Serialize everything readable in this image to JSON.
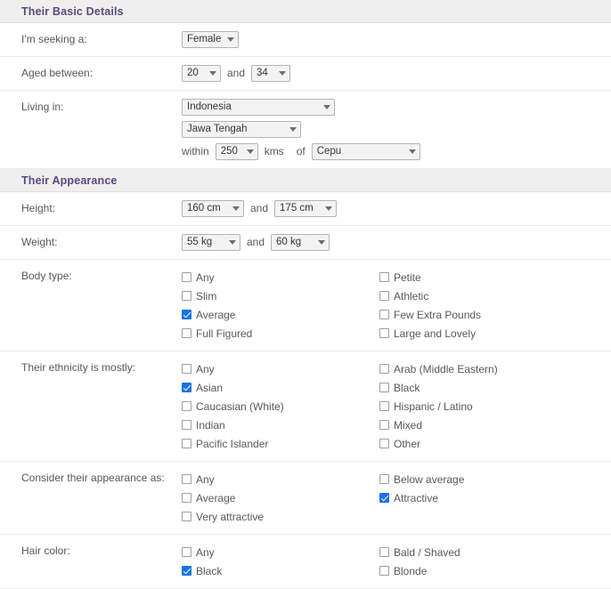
{
  "sections": [
    {
      "id": "basic-details",
      "title": "Their Basic Details",
      "rows": [
        {
          "id": "seeking",
          "label": "I'm seeking a:",
          "type": "select-row",
          "fields": [
            {
              "name": "seeking-select",
              "value": "Female",
              "size": "gender"
            }
          ]
        },
        {
          "id": "age",
          "label": "Aged between:",
          "type": "select-row",
          "fields": [
            {
              "name": "age-min-select",
              "value": "20",
              "size": "age"
            },
            {
              "name": "age-conjunction",
              "value": "and",
              "size": "word"
            },
            {
              "name": "age-max-select",
              "value": "34",
              "size": "age"
            }
          ]
        },
        {
          "id": "living-in",
          "label": "Living in:",
          "type": "stack-rows",
          "lines": [
            [
              {
                "name": "country-select",
                "value": "Indonesia",
                "size": "country"
              }
            ],
            [
              {
                "name": "region-select",
                "value": "Jawa Tengah",
                "size": "region"
              }
            ],
            [
              {
                "name": "within-word",
                "value": "within",
                "size": "word-first"
              },
              {
                "name": "distance-select",
                "value": "250",
                "size": "kms"
              },
              {
                "name": "kms-word",
                "value": "kms",
                "size": "word"
              },
              {
                "name": "of-word",
                "value": "of",
                "size": "word"
              },
              {
                "name": "city-select",
                "value": "Cepu",
                "size": "city"
              }
            ]
          ]
        }
      ]
    },
    {
      "id": "appearance",
      "title": "Their Appearance",
      "rows": [
        {
          "id": "height",
          "label": "Height:",
          "type": "select-row",
          "fields": [
            {
              "name": "height-min-select",
              "value": "160 cm",
              "size": "height"
            },
            {
              "name": "height-conjunction",
              "value": "and",
              "size": "word"
            },
            {
              "name": "height-max-select",
              "value": "175 cm",
              "size": "height"
            }
          ]
        },
        {
          "id": "weight",
          "label": "Weight:",
          "type": "select-row",
          "fields": [
            {
              "name": "weight-min-select",
              "value": "55 kg",
              "size": "weight"
            },
            {
              "name": "weight-conjunction",
              "value": "and",
              "size": "word"
            },
            {
              "name": "weight-max-select",
              "value": "60 kg",
              "size": "weight"
            }
          ]
        },
        {
          "id": "body-type",
          "label": "Body type:",
          "type": "checkbox-row",
          "left": [
            {
              "label": "Any",
              "checked": false
            },
            {
              "label": "Slim",
              "checked": false
            },
            {
              "label": "Average",
              "checked": true
            },
            {
              "label": "Full Figured",
              "checked": false
            }
          ],
          "right": [
            {
              "label": "Petite",
              "checked": false
            },
            {
              "label": "Athletic",
              "checked": false
            },
            {
              "label": "Few Extra Pounds",
              "checked": false
            },
            {
              "label": "Large and Lovely",
              "checked": false
            }
          ]
        },
        {
          "id": "ethnicity",
          "label": "Their ethnicity is mostly:",
          "type": "checkbox-row",
          "left": [
            {
              "label": "Any",
              "checked": false
            },
            {
              "label": "Asian",
              "checked": true
            },
            {
              "label": "Caucasian (White)",
              "checked": false
            },
            {
              "label": "Indian",
              "checked": false
            },
            {
              "label": "Pacific Islander",
              "checked": false
            }
          ],
          "right": [
            {
              "label": "Arab (Middle Eastern)",
              "checked": false
            },
            {
              "label": "Black",
              "checked": false
            },
            {
              "label": "Hispanic / Latino",
              "checked": false
            },
            {
              "label": "Mixed",
              "checked": false
            },
            {
              "label": "Other",
              "checked": false
            }
          ]
        },
        {
          "id": "appearance-rating",
          "label": "Consider their appearance as:",
          "type": "checkbox-row",
          "left": [
            {
              "label": "Any",
              "checked": false
            },
            {
              "label": "Average",
              "checked": false
            },
            {
              "label": "Very attractive",
              "checked": false
            }
          ],
          "right": [
            {
              "label": "Below average",
              "checked": false
            },
            {
              "label": "Attractive",
              "checked": true
            }
          ]
        },
        {
          "id": "hair-color",
          "label": "Hair color:",
          "type": "checkbox-row",
          "left": [
            {
              "label": "Any",
              "checked": false
            },
            {
              "label": "Black",
              "checked": true
            }
          ],
          "right": [
            {
              "label": "Bald / Shaved",
              "checked": false
            },
            {
              "label": "Blonde",
              "checked": false
            }
          ]
        }
      ]
    }
  ],
  "colors": {
    "section_header_bg": "#efefef",
    "section_header_text": "#5b4a7d",
    "checkbox_checked": "#1a73e8",
    "label_text": "#56595c",
    "row_divider": "#ededed",
    "select_bg": "#f3f3f3",
    "select_border": "#b4b4b4"
  }
}
